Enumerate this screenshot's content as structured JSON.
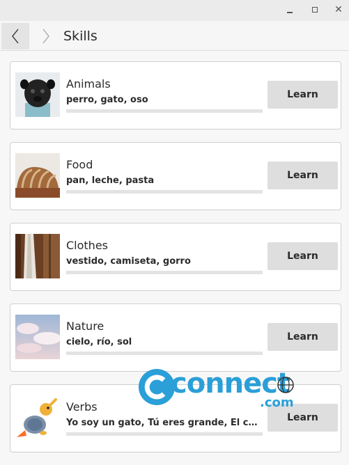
{
  "window": {
    "minimize_icon": "minimize-icon",
    "maximize_icon": "maximize-icon",
    "close_icon": "close-icon"
  },
  "header": {
    "title": "Skills",
    "back_icon": "chevron-left-icon",
    "forward_icon": "chevron-right-icon"
  },
  "skills": [
    {
      "name": "Animals",
      "words": "perro, gato, oso",
      "progress": 0,
      "button": "Learn",
      "image": "pug-dog-photo"
    },
    {
      "name": "Food",
      "words": "pan, leche, pasta",
      "progress": 0,
      "button": "Learn",
      "image": "sliced-bread-photo"
    },
    {
      "name": "Clothes",
      "words": "vestido, camiseta, gorro",
      "progress": 0,
      "button": "Learn",
      "image": "dress-on-wooden-door-photo"
    },
    {
      "name": "Nature",
      "words": "cielo, río, sol",
      "progress": 0,
      "button": "Learn",
      "image": "cloudy-sky-photo"
    },
    {
      "name": "Verbs",
      "words": "Yo soy un gato, Tú eres grande, El caballo es alto",
      "progress": 0,
      "button": "Learn",
      "image": "turtle-rocket-cartoon"
    }
  ],
  "watermark": {
    "text": "connect",
    "suffix": ".com"
  },
  "colors": {
    "button_bg": "#dedede",
    "progress_track": "#e3e3e3",
    "watermark": "#2a9fd8"
  }
}
